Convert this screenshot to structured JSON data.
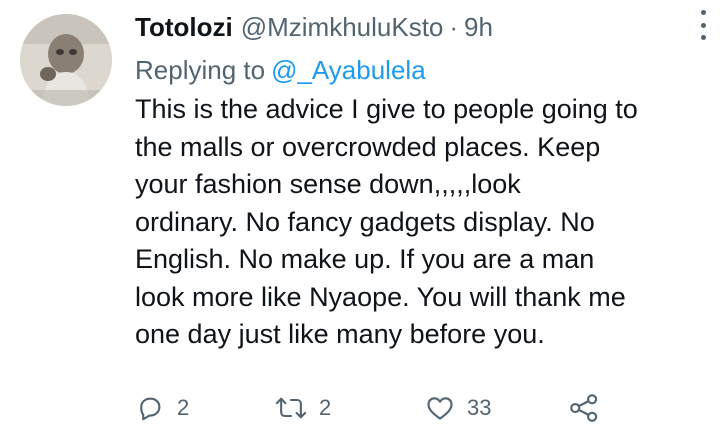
{
  "tweet": {
    "display_name": "Totolozi",
    "handle": "@MzimkhuluKsto",
    "separator": "·",
    "time": "9h",
    "replying_to_label": "Replying to",
    "replying_to_handle": "@_Ayabulela",
    "body_lines": [
      "This is the advice I give to people going to",
      "the malls or overcrowded places. Keep",
      "your fashion sense down,,,,,look",
      "ordinary. No fancy gadgets display. No",
      "English. No make up. If you are a man",
      "look more like Nyaope. You will thank me",
      "one day just like many before you."
    ]
  },
  "actions": {
    "reply_count": "2",
    "retweet_count": "2",
    "like_count": "33"
  },
  "icons": {
    "more": "more-vertical-icon",
    "reply": "reply-icon",
    "retweet": "retweet-icon",
    "like": "heart-icon",
    "share": "share-icon"
  },
  "colors": {
    "text": "#0f1419",
    "secondary": "#536471",
    "link": "#1d9bf0"
  }
}
